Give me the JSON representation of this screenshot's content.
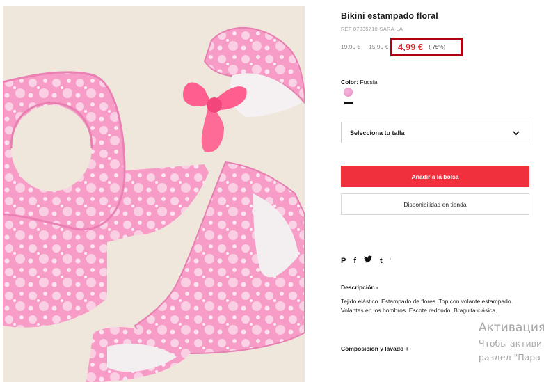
{
  "product": {
    "title": "Bikini estampado floral",
    "ref": "REF 87035710-SARA-LA",
    "image_alt": "pink floral bikini product photo"
  },
  "pricing": {
    "original_price": "19,99 €",
    "previous_price": "15,99 €",
    "current_price": "4,99 €",
    "discount": "(-75%)",
    "highlight_color": "#b00012",
    "price_color": "#e0202e"
  },
  "color": {
    "label": "Color:",
    "value": "Fucsia",
    "swatch_color": "#ef9bd0"
  },
  "size_select": {
    "placeholder": "Selecciona tu talla",
    "icon": "chevron-down-icon"
  },
  "actions": {
    "add_to_bag": "Añadir a la bolsa",
    "add_to_bag_color": "#f0303c",
    "store_availability": "Disponibilidad en tienda"
  },
  "social": {
    "icons": [
      "pinterest-icon",
      "facebook-icon",
      "twitter-icon",
      "tumblr-icon"
    ],
    "pinterest": "P",
    "facebook": "f",
    "twitter": "🐦",
    "tumblr": "t",
    "more": "'"
  },
  "description": {
    "title": "Descripción -",
    "text": "Tejido elástico. Estampado de flores. Top con volante estampado. Volantes en los hombros. Escote redondo. Braguita clásica."
  },
  "composition": {
    "title": "Composición y lavado +"
  },
  "watermark": {
    "title": "Активация",
    "line1": "Чтобы активи",
    "line2": "раздел \"Пара"
  }
}
